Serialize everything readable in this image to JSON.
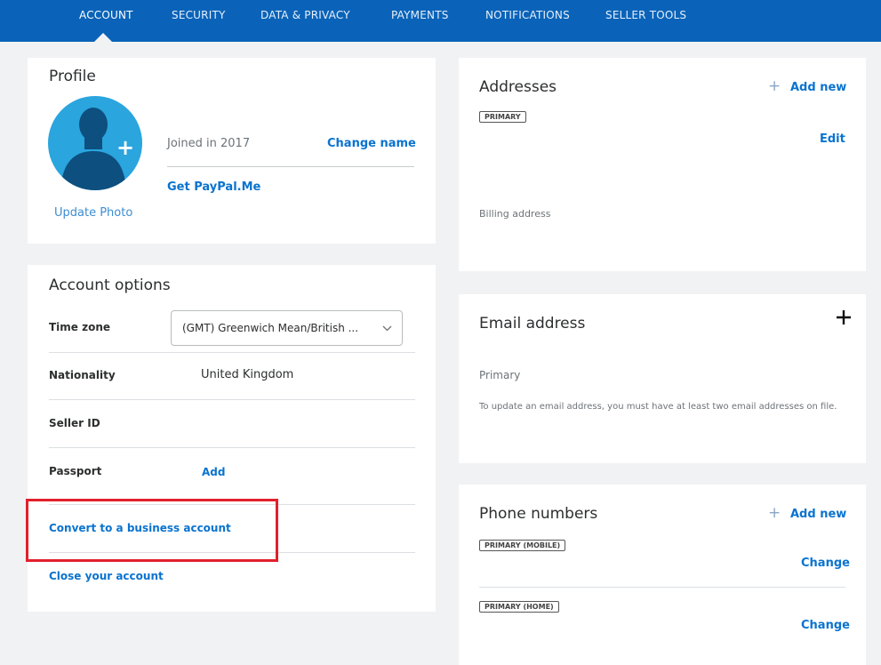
{
  "nav": {
    "tabs": [
      "ACCOUNT",
      "SECURITY",
      "DATA & PRIVACY",
      "PAYMENTS",
      "NOTIFICATIONS",
      "SELLER TOOLS"
    ]
  },
  "profile": {
    "title": "Profile",
    "update_photo": "Update Photo",
    "joined": "Joined in 2017",
    "change_name": "Change name",
    "paypal_me": "Get PayPal.Me"
  },
  "account_options": {
    "title": "Account options",
    "time_zone_label": "Time zone",
    "time_zone_value": "(GMT) Greenwich Mean/British ...",
    "nationality_label": "Nationality",
    "nationality_value": "United Kingdom",
    "seller_id_label": "Seller ID",
    "passport_label": "Passport",
    "passport_add": "Add",
    "convert": "Convert to a business account",
    "close": "Close your account"
  },
  "addresses": {
    "title": "Addresses",
    "add_new": "Add new",
    "badge": "PRIMARY",
    "edit": "Edit",
    "billing": "Billing address"
  },
  "email": {
    "title": "Email address",
    "primary": "Primary",
    "note": "To update an email address, you must have at least two email addresses on file."
  },
  "phones": {
    "title": "Phone numbers",
    "add_new": "Add new",
    "mobile_badge": "PRIMARY (MOBILE)",
    "mobile_change": "Change",
    "home_badge": "PRIMARY (HOME)",
    "home_change": "Change"
  },
  "colors": {
    "nav": "#0a63b8",
    "link": "#0a73cf",
    "avatar": "#2aa5de",
    "highlight": "#e2202c"
  }
}
